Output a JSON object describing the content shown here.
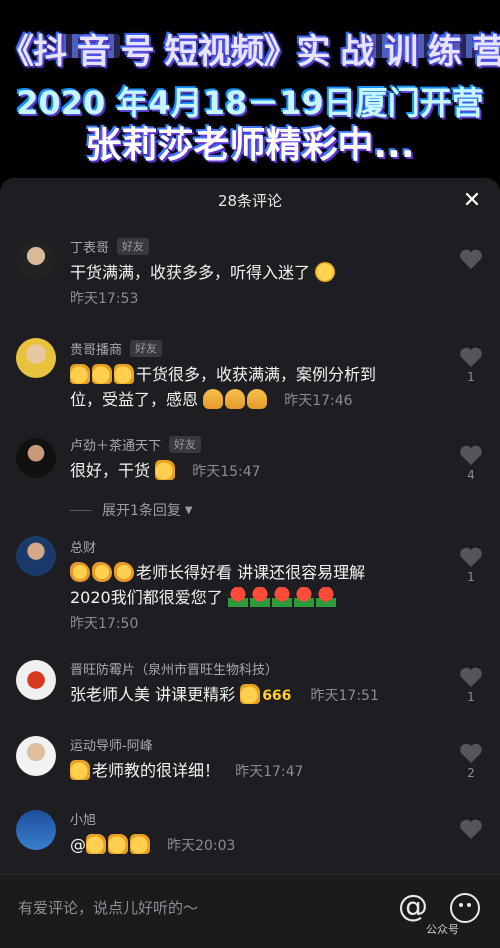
{
  "banner": {
    "line1": "《抖 音 号 短视频》实 战 训 练 营",
    "line2": "2020 年4月18－19日厦门开营",
    "line3": "张莉莎老师精彩中..."
  },
  "panel": {
    "title": "28条评论",
    "close_icon": "close-icon"
  },
  "comments": [
    {
      "name": "丁表哥",
      "badge": "好友",
      "text": "干货满满，收获多多，听得入迷了",
      "time": "昨天17:53",
      "likes": ""
    },
    {
      "name": "贵哥播商",
      "badge": "好友",
      "text1": "干货很多，收获满满，案例分析到",
      "text2": "位，受益了，感恩",
      "time": "昨天17:46",
      "likes": "1"
    },
    {
      "name": "卢劲＋茶通天下",
      "badge": "好友",
      "text": "很好，干货",
      "time": "昨天15:47",
      "likes": "4"
    },
    {
      "name": "总财",
      "badge": "",
      "text1": "老师长得好看 讲课还很容易理解",
      "text2": "2020我们都很爱您了",
      "time": "昨天17:50",
      "likes": "1"
    },
    {
      "name": "晋旺防霉片（泉州市晋旺生物科技）",
      "badge": "",
      "text": "张老师人美 讲课更精彩",
      "six": "666",
      "time": "昨天17:51",
      "likes": "1"
    },
    {
      "name": "运动导师-阿峰",
      "badge": "",
      "text": "老师教的很详细！",
      "time": "昨天17:47",
      "likes": "2"
    },
    {
      "name": "小旭",
      "badge": "",
      "text": "@",
      "time": "昨天20:03",
      "likes": ""
    }
  ],
  "expand": {
    "label": "展开1条回复"
  },
  "input": {
    "placeholder": "有爱评论，说点儿好听的～",
    "at": "@",
    "watermark": "公众号"
  },
  "colors": {
    "panel_bg": "#1e1e22",
    "text": "#f2f2f2",
    "muted": "#8b8b90"
  }
}
